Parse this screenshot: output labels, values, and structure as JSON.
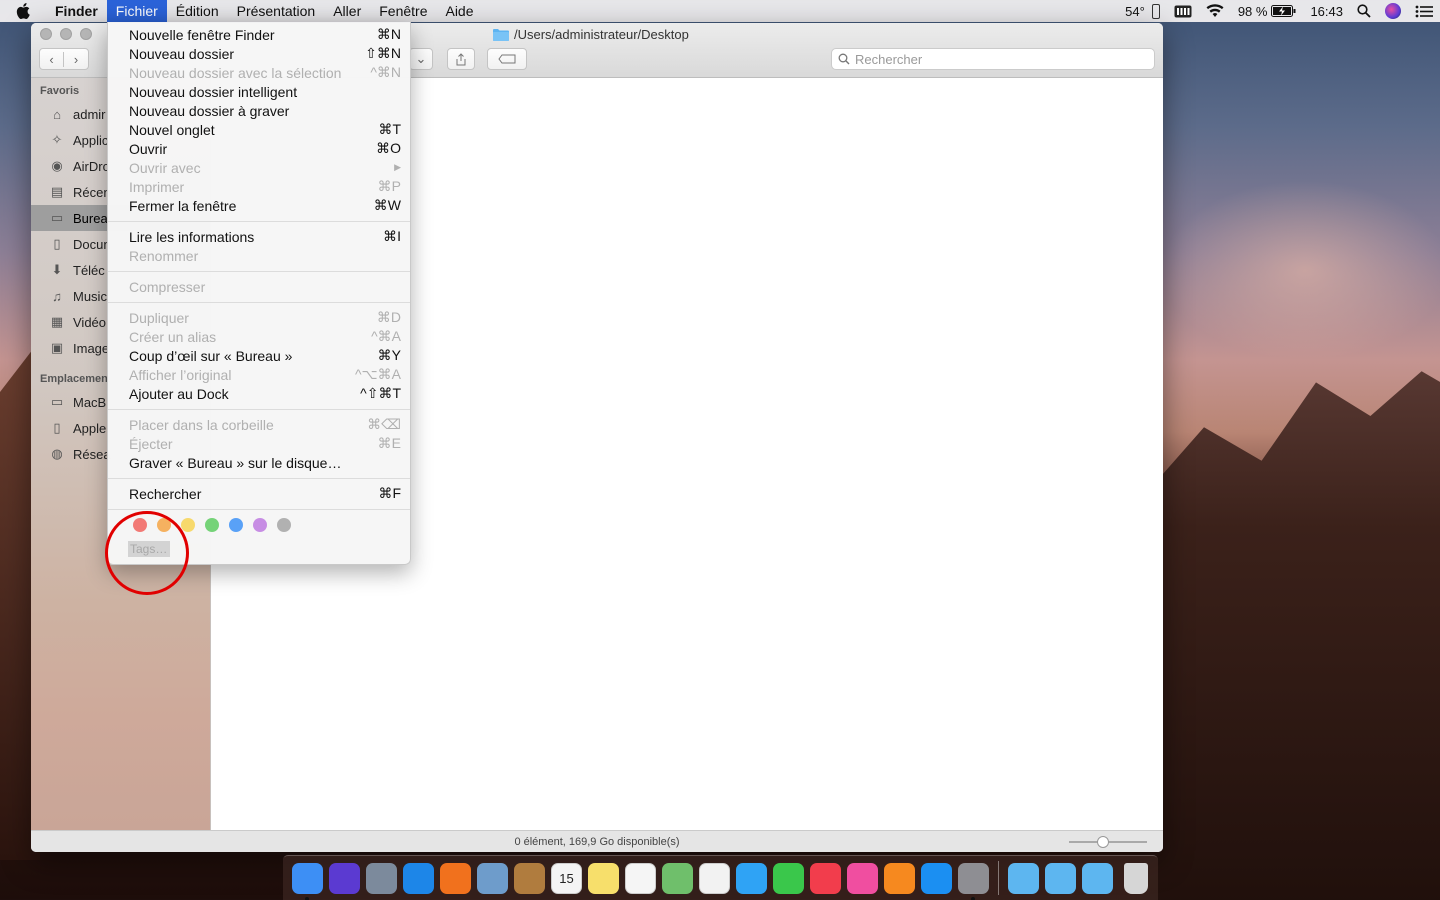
{
  "menubar": {
    "app_name": "Finder",
    "menus": [
      "Fichier",
      "Édition",
      "Présentation",
      "Aller",
      "Fenêtre",
      "Aide"
    ],
    "active_menu": "Fichier",
    "temperature": "54°",
    "battery": "98 %",
    "time": "16:43"
  },
  "window": {
    "title": "/Users/administrateur/Desktop",
    "search_placeholder": "Rechercher",
    "status": "0 élément, 169,9 Go disponible(s)"
  },
  "sidebar": {
    "favorites_header": "Favoris",
    "favorites": [
      {
        "label": "admir",
        "icon": "home-icon"
      },
      {
        "label": "Applic",
        "icon": "applications-icon"
      },
      {
        "label": "AirDro",
        "icon": "airdrop-icon"
      },
      {
        "label": "Récen",
        "icon": "recents-icon"
      },
      {
        "label": "Burea",
        "icon": "desktop-icon",
        "selected": true
      },
      {
        "label": "Docun",
        "icon": "documents-icon"
      },
      {
        "label": "Téléc",
        "icon": "downloads-icon"
      },
      {
        "label": "Music",
        "icon": "music-icon"
      },
      {
        "label": "Vidéo",
        "icon": "movies-icon"
      },
      {
        "label": "Image",
        "icon": "pictures-icon"
      }
    ],
    "locations_header": "Emplacemen",
    "locations": [
      {
        "label": "MacB",
        "icon": "laptop-icon"
      },
      {
        "label": "Apple",
        "icon": "disk-icon"
      },
      {
        "label": "Résea",
        "icon": "network-icon"
      }
    ]
  },
  "file_menu": {
    "groups": [
      [
        {
          "label": "Nouvelle fenêtre Finder",
          "shortcut": "⌘N",
          "enabled": true
        },
        {
          "label": "Nouveau dossier",
          "shortcut": "⇧⌘N",
          "enabled": true
        },
        {
          "label": "Nouveau dossier avec la sélection",
          "shortcut": "^⌘N",
          "enabled": false
        },
        {
          "label": "Nouveau dossier intelligent",
          "shortcut": "",
          "enabled": true
        },
        {
          "label": "Nouveau dossier à graver",
          "shortcut": "",
          "enabled": true
        },
        {
          "label": "Nouvel onglet",
          "shortcut": "⌘T",
          "enabled": true
        },
        {
          "label": "Ouvrir",
          "shortcut": "⌘O",
          "enabled": true
        },
        {
          "label": "Ouvrir avec",
          "shortcut": "▶",
          "enabled": false
        },
        {
          "label": "Imprimer",
          "shortcut": "⌘P",
          "enabled": false
        },
        {
          "label": "Fermer la fenêtre",
          "shortcut": "⌘W",
          "enabled": true
        }
      ],
      [
        {
          "label": "Lire les informations",
          "shortcut": "⌘I",
          "enabled": true
        },
        {
          "label": "Renommer",
          "shortcut": "",
          "enabled": false
        }
      ],
      [
        {
          "label": "Compresser",
          "shortcut": "",
          "enabled": false
        }
      ],
      [
        {
          "label": "Dupliquer",
          "shortcut": "⌘D",
          "enabled": false
        },
        {
          "label": "Créer un alias",
          "shortcut": "^⌘A",
          "enabled": false
        },
        {
          "label": "Coup d’œil sur « Bureau »",
          "shortcut": "⌘Y",
          "enabled": true
        },
        {
          "label": "Afficher l’original",
          "shortcut": "^⌥⌘A",
          "enabled": false
        },
        {
          "label": "Ajouter au Dock",
          "shortcut": "^⇧⌘T",
          "enabled": true
        }
      ],
      [
        {
          "label": "Placer dans la corbeille",
          "shortcut": "⌘⌫",
          "enabled": false
        },
        {
          "label": "Éjecter",
          "shortcut": "⌘E",
          "enabled": false
        },
        {
          "label": "Graver « Bureau » sur le disque…",
          "shortcut": "",
          "enabled": true
        }
      ],
      [
        {
          "label": "Rechercher",
          "shortcut": "⌘F",
          "enabled": true
        }
      ]
    ],
    "tag_colors": [
      "#f1635e",
      "#f5a545",
      "#f7d453",
      "#5ecc62",
      "#3d92f7",
      "#be7ae0",
      "#a5a5a5"
    ],
    "tags_label": "Tags…"
  },
  "dock": {
    "apps": [
      {
        "name": "finder-icon",
        "color": "#3d8ff5",
        "running": true
      },
      {
        "name": "siri-icon",
        "color": "#5b3ad1"
      },
      {
        "name": "launchpad-icon",
        "color": "#7c8a9c"
      },
      {
        "name": "safari-icon",
        "color": "#1d86e8"
      },
      {
        "name": "firefox-icon",
        "color": "#f1711d"
      },
      {
        "name": "preview-icon",
        "color": "#6e9ccb"
      },
      {
        "name": "contacts-icon",
        "color": "#b07c3e"
      },
      {
        "name": "calendar-icon",
        "color": "#f4f4f4",
        "text": "15"
      },
      {
        "name": "notes-icon",
        "color": "#f7df6b"
      },
      {
        "name": "reminders-icon",
        "color": "#f5f5f5"
      },
      {
        "name": "maps-icon",
        "color": "#6fbf6b"
      },
      {
        "name": "photos-icon",
        "color": "#f2f2f2"
      },
      {
        "name": "messages-icon",
        "color": "#2fa3f5"
      },
      {
        "name": "facetime-icon",
        "color": "#3ac74b"
      },
      {
        "name": "news-icon",
        "color": "#f23d4c"
      },
      {
        "name": "itunes-icon",
        "color": "#f04ea0"
      },
      {
        "name": "books-icon",
        "color": "#f6891f"
      },
      {
        "name": "appstore-icon",
        "color": "#1b8ff2"
      },
      {
        "name": "system-preferences-icon",
        "color": "#8e8e93",
        "running": true
      }
    ],
    "folders": [
      {
        "name": "applications-folder-icon",
        "color": "#5db6f0"
      },
      {
        "name": "documents-folder-icon",
        "color": "#5db6f0"
      },
      {
        "name": "downloads-folder-icon",
        "color": "#5db6f0"
      },
      {
        "name": "trash-icon",
        "color": "#d6d6d6"
      }
    ]
  }
}
